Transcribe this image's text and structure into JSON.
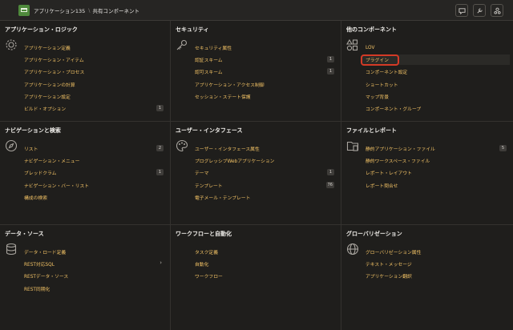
{
  "header": {
    "app_label": "アプリケーション135",
    "separator": "\\",
    "page_label": "共有コンポーネント"
  },
  "panels": [
    {
      "title": "アプリケーション・ロジック",
      "icon": "gear-icon",
      "items": [
        {
          "label": "アプリケーション定義",
          "badge": ""
        },
        {
          "label": "アプリケーション・アイテム",
          "badge": ""
        },
        {
          "label": "アプリケーション・プロセス",
          "badge": ""
        },
        {
          "label": "アプリケーションの計算",
          "badge": ""
        },
        {
          "label": "アプリケーション設定",
          "badge": ""
        },
        {
          "label": "ビルド・オプション",
          "badge": "1"
        }
      ]
    },
    {
      "title": "セキュリティ",
      "icon": "key-icon",
      "items": [
        {
          "label": "セキュリティ属性",
          "badge": ""
        },
        {
          "label": "認証スキーム",
          "badge": "1"
        },
        {
          "label": "認可スキーム",
          "badge": "1"
        },
        {
          "label": "アプリケーション・アクセス制御",
          "badge": ""
        },
        {
          "label": "セッション・ステート保護",
          "badge": ""
        }
      ]
    },
    {
      "title": "他のコンポーネント",
      "icon": "shapes-icon",
      "items": [
        {
          "label": "LOV",
          "badge": ""
        },
        {
          "label": "プラグイン",
          "badge": "",
          "highlighted": true
        },
        {
          "label": "コンポーネント設定",
          "badge": ""
        },
        {
          "label": "ショートカット",
          "badge": ""
        },
        {
          "label": "マップ背景",
          "badge": ""
        },
        {
          "label": "コンポーネント・グループ",
          "badge": ""
        }
      ]
    },
    {
      "title": "ナビゲーションと検索",
      "icon": "compass-icon",
      "items": [
        {
          "label": "リスト",
          "badge": "2"
        },
        {
          "label": "ナビゲーション・メニュー",
          "badge": ""
        },
        {
          "label": "ブレッドクラム",
          "badge": "1"
        },
        {
          "label": "ナビゲーション・バー・リスト",
          "badge": ""
        },
        {
          "label": "構成の検索",
          "badge": ""
        }
      ]
    },
    {
      "title": "ユーザー・インタフェース",
      "icon": "palette-icon",
      "items": [
        {
          "label": "ユーザー・インタフェース属性",
          "badge": ""
        },
        {
          "label": "プログレッシブWebアプリケーション",
          "badge": ""
        },
        {
          "label": "テーマ",
          "badge": "1"
        },
        {
          "label": "テンプレート",
          "badge": "76"
        },
        {
          "label": "電子メール・テンプレート",
          "badge": ""
        }
      ]
    },
    {
      "title": "ファイルとレポート",
      "icon": "folder-icon",
      "items": [
        {
          "label": "静的アプリケーション・ファイル",
          "badge": "5"
        },
        {
          "label": "静的ワークスペース・ファイル",
          "badge": ""
        },
        {
          "label": "レポート・レイアウト",
          "badge": ""
        },
        {
          "label": "レポート問合せ",
          "badge": ""
        }
      ]
    },
    {
      "title": "データ・ソース",
      "icon": "database-icon",
      "items": [
        {
          "label": "データ・ロード定義",
          "badge": ""
        },
        {
          "label": "REST対応SQL",
          "badge": "",
          "chevron": "›"
        },
        {
          "label": "RESTデータ・ソース",
          "badge": ""
        },
        {
          "label": "REST同期化",
          "badge": ""
        }
      ]
    },
    {
      "title": "ワークフローと自動化",
      "icon": "",
      "items": [
        {
          "label": "タスク定義",
          "badge": ""
        },
        {
          "label": "自動化",
          "badge": ""
        },
        {
          "label": "ワークフロー",
          "badge": ""
        }
      ]
    },
    {
      "title": "グローバリゼーション",
      "icon": "globe-icon",
      "items": [
        {
          "label": "グローバリゼーション属性",
          "badge": ""
        },
        {
          "label": "テキスト・メッセージ",
          "badge": ""
        },
        {
          "label": "アプリケーション翻訳",
          "badge": ""
        }
      ]
    }
  ]
}
